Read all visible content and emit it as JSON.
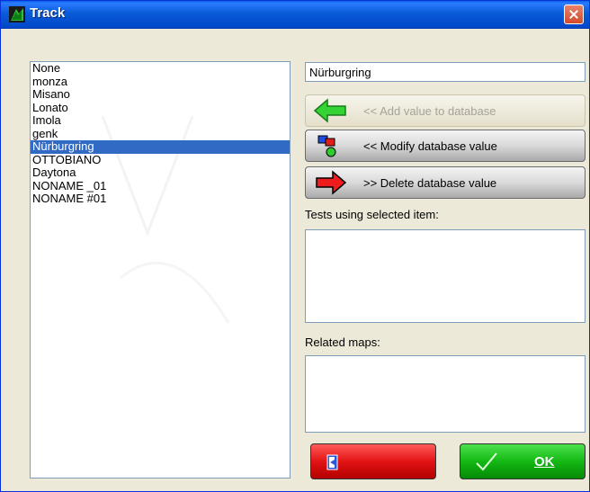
{
  "window": {
    "title": "Track"
  },
  "tracks": {
    "items": [
      "None",
      "monza",
      "Misano",
      "Lonato",
      "Imola",
      "genk",
      "Nürburgring",
      "OTTOBIANO",
      "Daytona",
      "NONAME _01",
      "NONAME #01"
    ],
    "selected": "Nürburgring"
  },
  "name_field": {
    "value": "Nürburgring"
  },
  "buttons": {
    "add": "<< Add value to database",
    "modify": "<< Modify database value",
    "delete": ">> Delete database value",
    "ok": "OK"
  },
  "labels": {
    "tests": "Tests using selected item:",
    "maps": "Related maps:"
  },
  "colors": {
    "selection": "#316ac5",
    "cancel": "#e21414",
    "ok": "#14b814"
  }
}
